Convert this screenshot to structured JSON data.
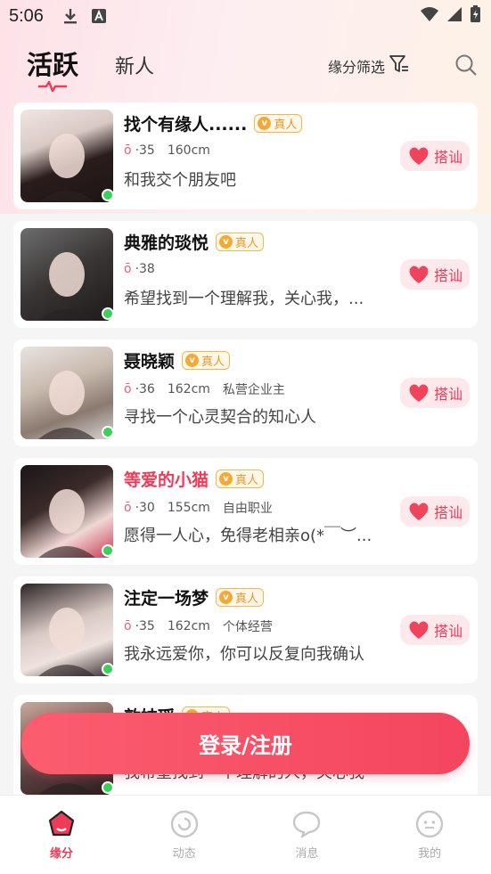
{
  "status_bar": {
    "time": "5:06"
  },
  "nav": {
    "tab_active": "活跃",
    "tab_new": "新人",
    "filter_label": "缘分筛选"
  },
  "real_badge": "真人",
  "greet_label": "搭讪",
  "cards": [
    {
      "name": "找个有缘人......",
      "age": "·35",
      "height": "160cm",
      "job": "",
      "bio": "和我交个朋友吧",
      "highlight": false
    },
    {
      "name": "典雅的琰悦",
      "age": "·38",
      "height": "",
      "job": "",
      "bio": "希望找到一个理解我，关心我，...",
      "highlight": false
    },
    {
      "name": "聂晓颖",
      "age": "·36",
      "height": "162cm",
      "job": "私营企业主",
      "bio": "寻找一个心灵契合的知心人",
      "highlight": false
    },
    {
      "name": "等爱的小猫",
      "age": "·30",
      "height": "155cm",
      "job": "自由职业",
      "bio": "愿得一人心，免得老相亲o(*￣︶...",
      "highlight": true
    },
    {
      "name": "注定一场梦",
      "age": "·35",
      "height": "162cm",
      "job": "个体经营",
      "bio": "我永远爱你，你可以反复向我确认",
      "highlight": false
    },
    {
      "name": "敦妹瑶",
      "age": "",
      "height": "",
      "job": "",
      "bio": "我希望找到一个理解的人，关心我",
      "highlight": false
    }
  ],
  "login_button": "登录/注册",
  "bottom_tabs": [
    "缘分",
    "动态",
    "消息",
    "我的"
  ],
  "colors": {
    "accent": "#ee3b57",
    "badge": "#f2a938",
    "online": "#3ccf5a"
  }
}
